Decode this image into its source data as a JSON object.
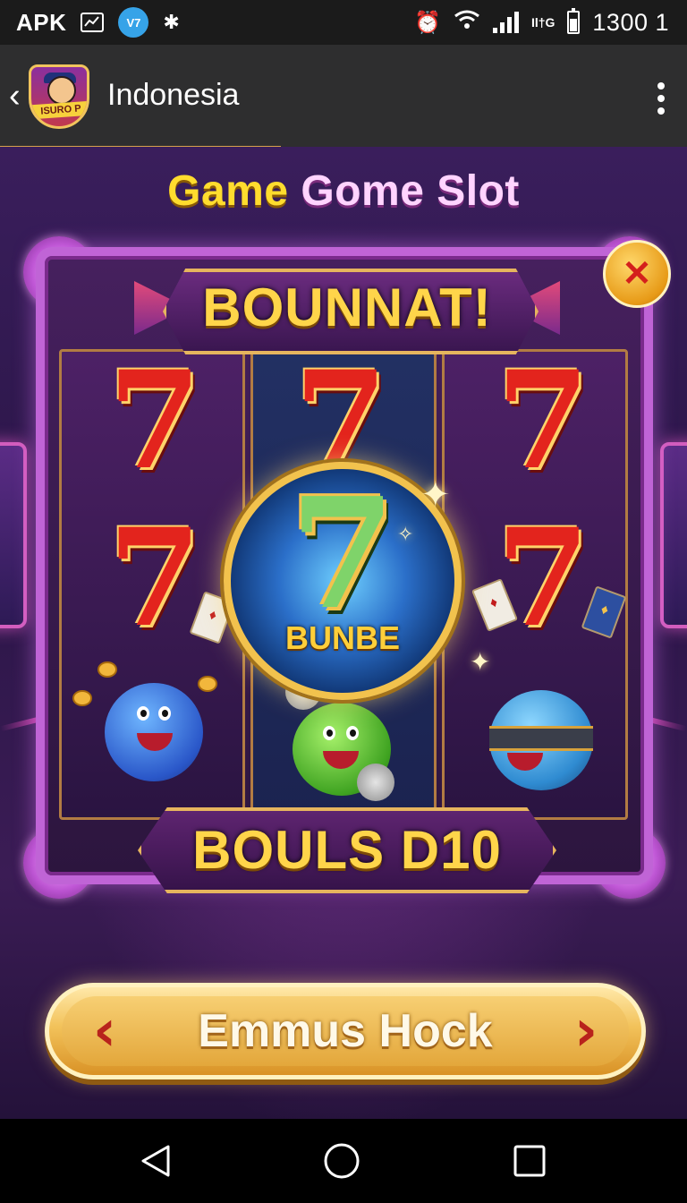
{
  "status_bar": {
    "apk_label": "APK",
    "circle_label": "V7",
    "lte_label": "Il†G",
    "time": "1300 1",
    "icons": [
      "gallery-icon",
      "app-badge-icon",
      "bug-icon",
      "alarm-icon",
      "wifi-icon",
      "signal-icon",
      "battery-icon"
    ]
  },
  "app_bar": {
    "title": "Indonesia",
    "logo_text": "ISURO P",
    "accent_color": "#d6a24a"
  },
  "game": {
    "title_part1": "Game",
    "title_part2": "Gome Slot",
    "top_banner": "BOUNNAT!",
    "center_label": "BUNBE",
    "bottom_banner": "BOULS D10",
    "action_button": "Emmus Hock",
    "close_symbol": "✕",
    "symbol_seven": "7",
    "colors": {
      "frame": "#c064d6",
      "gold": "#ffd54a",
      "close": "#e79a17"
    }
  },
  "nav_bar": {
    "icons": [
      "back-triangle-icon",
      "home-circle-icon",
      "recents-square-icon"
    ]
  }
}
